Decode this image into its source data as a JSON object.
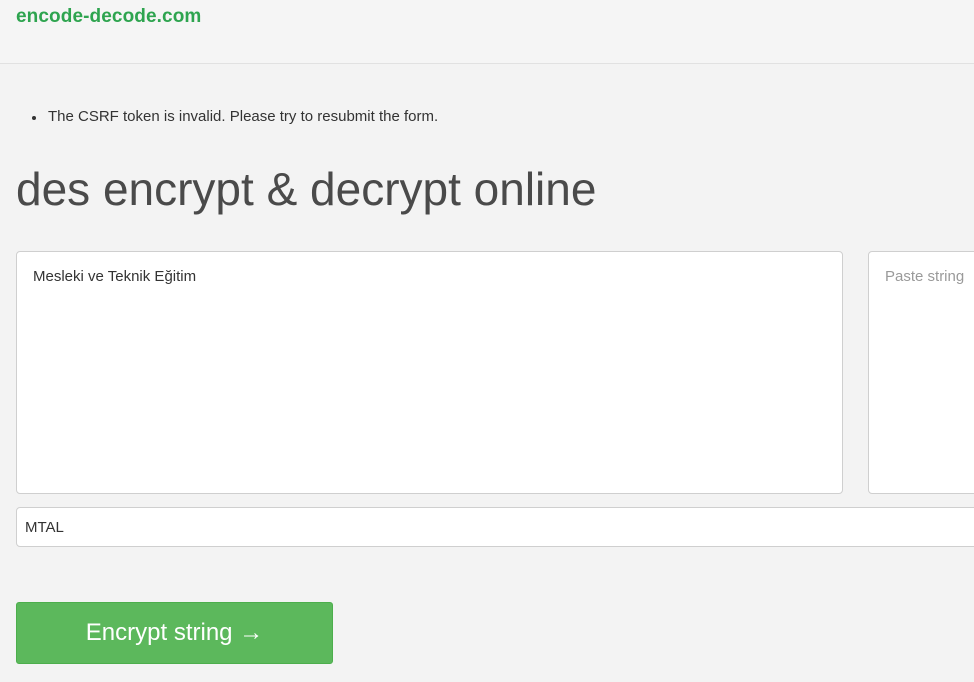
{
  "header": {
    "brand": "encode-decode.com"
  },
  "errors": [
    "The CSRF token is invalid. Please try to resubmit the form."
  ],
  "main": {
    "title": "des encrypt & decrypt online",
    "input_text": "Mesleki ve Teknik Eğitim",
    "output_placeholder": "Paste string",
    "key_value": "MTAL",
    "encrypt_button_label": "Encrypt string →"
  },
  "colors": {
    "brand": "#2ea44f",
    "button": "#5cb85c"
  }
}
